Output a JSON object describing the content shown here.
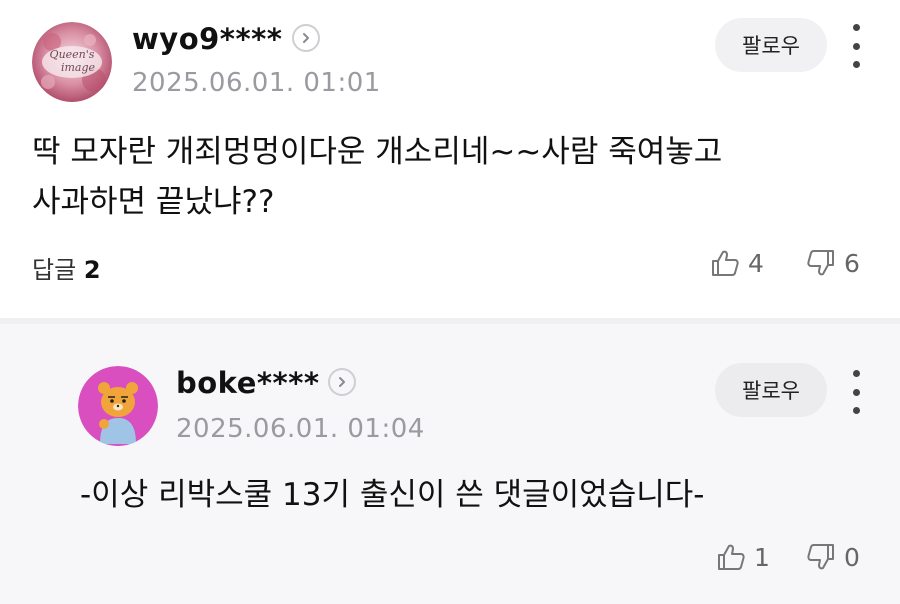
{
  "comments": [
    {
      "username": "wyo9****",
      "avatar_text": "Queen's image",
      "date": "2025.06.01. 01:01",
      "follow_label": "팔로우",
      "body": "딱 모자란 개죄멍멍이다운 개소리네~~사람 죽여놓고\n사과하면 끝났냐??",
      "replies_label": "답글",
      "replies_count": "2",
      "likes": "4",
      "dislikes": "6"
    },
    {
      "username": "boke****",
      "date": "2025.06.01. 01:04",
      "follow_label": "팔로우",
      "body": "-이상 리박스쿨 13기 출신이 쓴 댓글이었습니다-",
      "likes": "1",
      "dislikes": "0"
    }
  ],
  "icons": {
    "chevron": "chevron-right-icon",
    "more": "more-vertical-icon",
    "like": "thumbs-up-icon",
    "dislike": "thumbs-down-icon"
  },
  "colors": {
    "divider": "#f0f0f2",
    "reply_bg": "#f7f7f9",
    "meta_gray": "#9a9aa0"
  }
}
